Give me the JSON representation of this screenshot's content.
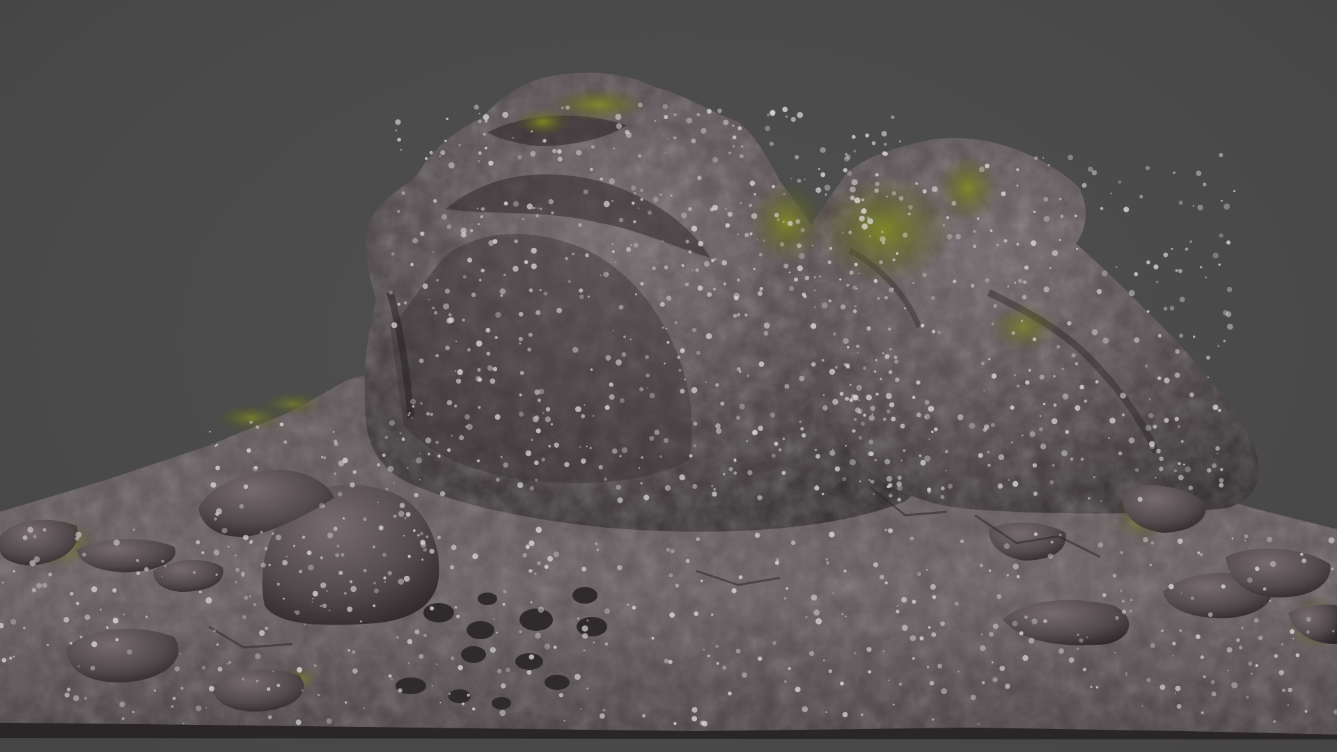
{
  "scene": {
    "subject": "rock-formation-scan",
    "background_color": "#4a4a4a",
    "rock_base_color": "#5a5052",
    "rock_shadow_color": "#2e2a2c",
    "rock_highlight_color": "#8a8083",
    "moss_color": "#6f7a22",
    "lichen_color": "#d8d6d4"
  }
}
